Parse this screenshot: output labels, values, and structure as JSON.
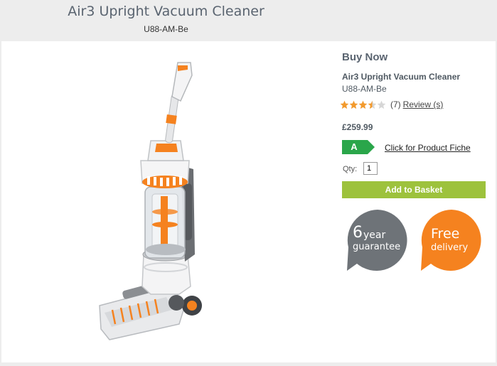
{
  "header": {
    "title": "Air3 Upright Vacuum Cleaner",
    "sku": "U88-AM-Be"
  },
  "product_panel": {
    "heading": "Buy Now",
    "name": "Air3 Upright Vacuum Cleaner",
    "sku": "U88-AM-Be",
    "rating": {
      "value": 3.5,
      "max": 5,
      "count_text": "(7)",
      "review_link": "Review (s)"
    },
    "price": "£259.99",
    "energy_class": "A",
    "fiche_link": "Click for Product Fiche",
    "qty_label": "Qty:",
    "qty_value": "1",
    "add_button": "Add to Basket",
    "guarantee_badge": {
      "number": "6",
      "word1": "year",
      "word2": "guarantee"
    },
    "delivery_badge": {
      "line1": "Free",
      "line2": "delivery"
    }
  },
  "colors": {
    "accent_orange": "#f5821f",
    "badge_grey": "#6e7378",
    "energy_green": "#2aa64a",
    "button_green": "#9dc23c",
    "star_orange": "#f29a2e"
  },
  "icons": [
    "star-icon",
    "vacuum-cleaner-image"
  ]
}
